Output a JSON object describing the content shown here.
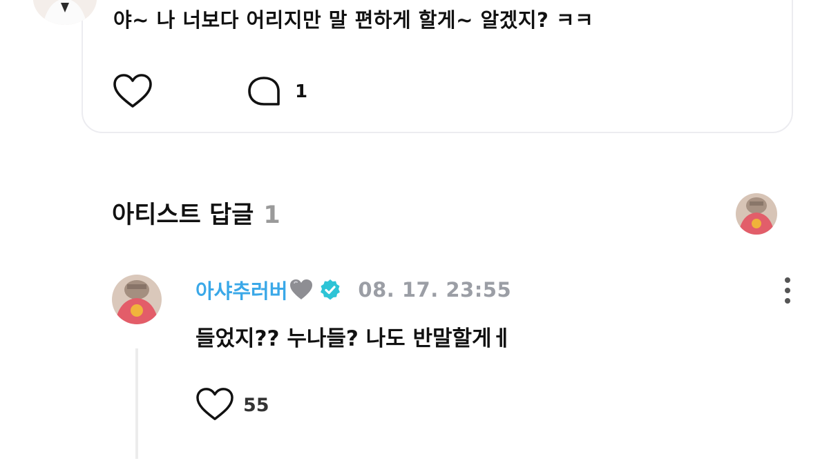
{
  "post": {
    "text": "야~ 나 너보다 어리지만 말 편하게 할게~ 알겠지? ㅋㅋ",
    "comment_count": "1"
  },
  "artist_replies": {
    "title": "아티스트 답글",
    "count": "1"
  },
  "reply": {
    "author": "아샤추러버",
    "timestamp": "08. 17. 23:55",
    "text": "들었지?? 누나들? 나도 반말할게ㅔ",
    "like_count": "55"
  },
  "colors": {
    "author_name": "#3aa8e8",
    "verified_badge": "#2ec4d6",
    "timestamp": "#9b9ea5",
    "section_count": "#9a9a9a",
    "grey_heart": "#8e8e93"
  },
  "icons": {
    "post_like": "heart-outline-icon",
    "post_comment": "speech-bubble-icon",
    "grey_heart": "grey-heart-emoji-icon",
    "verified": "verified-badge-icon",
    "reply_like": "heart-outline-icon",
    "more": "vertical-ellipsis-icon"
  }
}
